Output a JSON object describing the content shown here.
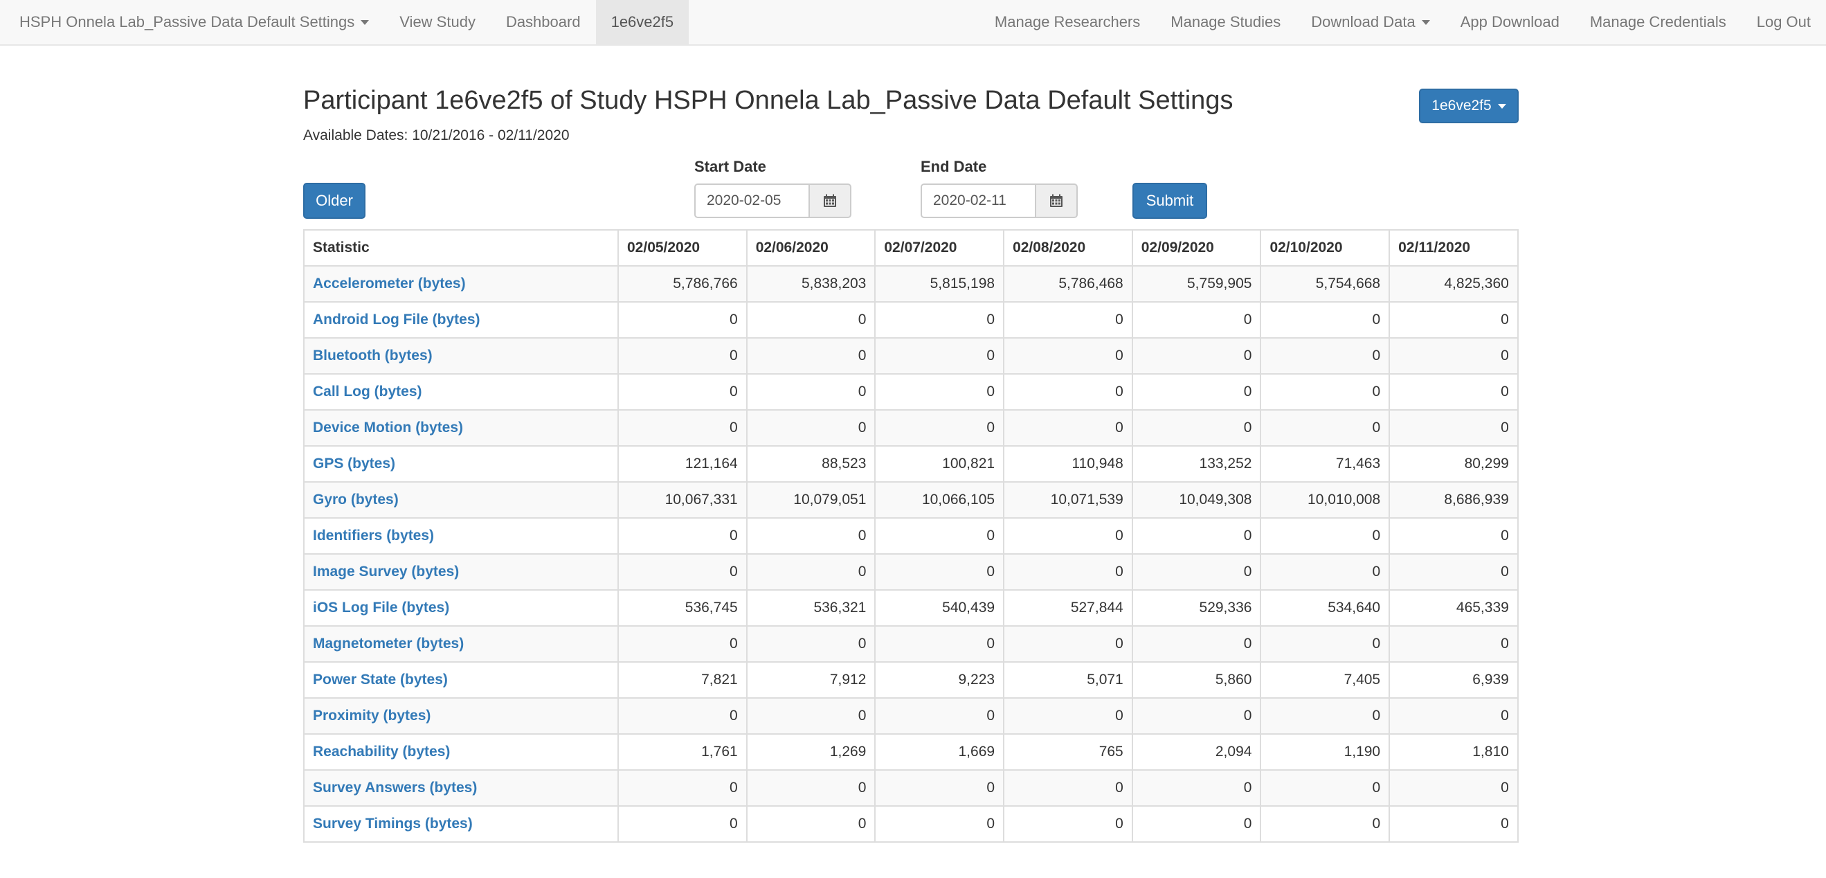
{
  "navbar": {
    "brand": "HSPH Onnela Lab_Passive Data Default Settings",
    "left_items": [
      {
        "label": "View Study"
      },
      {
        "label": "Dashboard"
      },
      {
        "label": "1e6ve2f5"
      }
    ],
    "right_items": [
      {
        "label": "Manage Researchers"
      },
      {
        "label": "Manage Studies"
      },
      {
        "label": "Download Data"
      },
      {
        "label": "App Download"
      },
      {
        "label": "Manage Credentials"
      },
      {
        "label": "Log Out"
      }
    ],
    "active_tab": "1e6ve2f5"
  },
  "header": {
    "title": "Participant 1e6ve2f5 of Study HSPH Onnela Lab_Passive Data Default Settings",
    "available_dates": "Available Dates: 10/21/2016 - 02/11/2020",
    "participant_dropdown": "1e6ve2f5"
  },
  "controls": {
    "older_label": "Older",
    "start_date_label": "Start Date",
    "start_date_value": "2020-02-05",
    "end_date_label": "End Date",
    "end_date_value": "2020-02-11",
    "submit_label": "Submit",
    "calendar_icon": "calendar-icon"
  },
  "table": {
    "headers": [
      "Statistic",
      "02/05/2020",
      "02/06/2020",
      "02/07/2020",
      "02/08/2020",
      "02/09/2020",
      "02/10/2020",
      "02/11/2020"
    ],
    "rows": [
      {
        "label": "Accelerometer (bytes)",
        "values": [
          "5,786,766",
          "5,838,203",
          "5,815,198",
          "5,786,468",
          "5,759,905",
          "5,754,668",
          "4,825,360"
        ]
      },
      {
        "label": "Android Log File (bytes)",
        "values": [
          "0",
          "0",
          "0",
          "0",
          "0",
          "0",
          "0"
        ]
      },
      {
        "label": "Bluetooth (bytes)",
        "values": [
          "0",
          "0",
          "0",
          "0",
          "0",
          "0",
          "0"
        ]
      },
      {
        "label": "Call Log (bytes)",
        "values": [
          "0",
          "0",
          "0",
          "0",
          "0",
          "0",
          "0"
        ]
      },
      {
        "label": "Device Motion (bytes)",
        "values": [
          "0",
          "0",
          "0",
          "0",
          "0",
          "0",
          "0"
        ]
      },
      {
        "label": "GPS (bytes)",
        "values": [
          "121,164",
          "88,523",
          "100,821",
          "110,948",
          "133,252",
          "71,463",
          "80,299"
        ]
      },
      {
        "label": "Gyro (bytes)",
        "values": [
          "10,067,331",
          "10,079,051",
          "10,066,105",
          "10,071,539",
          "10,049,308",
          "10,010,008",
          "8,686,939"
        ]
      },
      {
        "label": "Identifiers (bytes)",
        "values": [
          "0",
          "0",
          "0",
          "0",
          "0",
          "0",
          "0"
        ]
      },
      {
        "label": "Image Survey (bytes)",
        "values": [
          "0",
          "0",
          "0",
          "0",
          "0",
          "0",
          "0"
        ]
      },
      {
        "label": "iOS Log File (bytes)",
        "values": [
          "536,745",
          "536,321",
          "540,439",
          "527,844",
          "529,336",
          "534,640",
          "465,339"
        ]
      },
      {
        "label": "Magnetometer (bytes)",
        "values": [
          "0",
          "0",
          "0",
          "0",
          "0",
          "0",
          "0"
        ]
      },
      {
        "label": "Power State (bytes)",
        "values": [
          "7,821",
          "7,912",
          "9,223",
          "5,071",
          "5,860",
          "7,405",
          "6,939"
        ]
      },
      {
        "label": "Proximity (bytes)",
        "values": [
          "0",
          "0",
          "0",
          "0",
          "0",
          "0",
          "0"
        ]
      },
      {
        "label": "Reachability (bytes)",
        "values": [
          "1,761",
          "1,269",
          "1,669",
          "765",
          "2,094",
          "1,190",
          "1,810"
        ]
      },
      {
        "label": "Survey Answers (bytes)",
        "values": [
          "0",
          "0",
          "0",
          "0",
          "0",
          "0",
          "0"
        ]
      },
      {
        "label": "Survey Timings (bytes)",
        "values": [
          "0",
          "0",
          "0",
          "0",
          "0",
          "0",
          "0"
        ]
      }
    ]
  },
  "colors": {
    "primary": "#337ab7",
    "link": "#337ab7",
    "navbar_bg": "#f8f8f8",
    "navbar_active": "#e7e7e7"
  }
}
